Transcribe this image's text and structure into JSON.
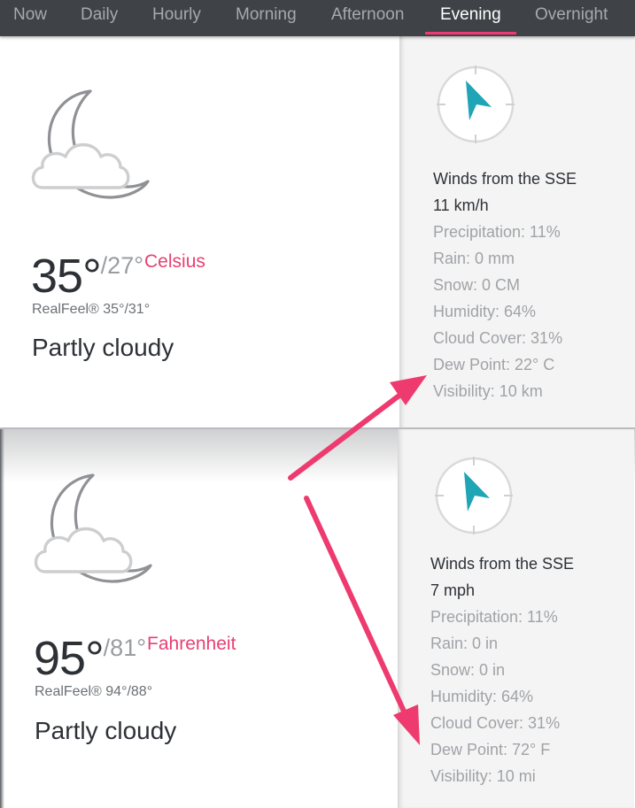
{
  "nav": {
    "tabs": [
      {
        "label": "Now",
        "active": false
      },
      {
        "label": "Daily",
        "active": false
      },
      {
        "label": "Hourly",
        "active": false
      },
      {
        "label": "Morning",
        "active": false
      },
      {
        "label": "Afternoon",
        "active": false
      },
      {
        "label": "Evening",
        "active": true
      },
      {
        "label": "Overnight",
        "active": false
      }
    ]
  },
  "colors": {
    "accent": "#f03a74",
    "compass_arrow": "#1fa5b5",
    "nav_bg": "#3f4347"
  },
  "celsius": {
    "icon": "partly-cloudy-night-icon",
    "temp_high": "35°",
    "temp_low": "/27°",
    "unit_label": "Celsius",
    "realfeel": "RealFeel® 35°/31°",
    "phrase": "Partly cloudy",
    "wind_direction": "Winds from the SSE",
    "wind_speed": "11 km/h",
    "precipitation": "Precipitation: 11%",
    "rain": "Rain: 0 mm",
    "snow": "Snow: 0 CM",
    "humidity": "Humidity: 64%",
    "cloud_cover": "Cloud Cover: 31%",
    "dew_point": "Dew Point: 22° C",
    "visibility": "Visibility: 10 km"
  },
  "fahrenheit": {
    "icon": "partly-cloudy-night-icon",
    "temp_high": "95°",
    "temp_low": "/81°",
    "unit_label": "Fahrenheit",
    "realfeel": "RealFeel® 94°/88°",
    "phrase": "Partly cloudy",
    "wind_direction": "Winds from the SSE",
    "wind_speed": "7 mph",
    "precipitation": "Precipitation: 11%",
    "rain": "Rain: 0 in",
    "snow": "Snow: 0 in",
    "humidity": "Humidity: 64%",
    "cloud_cover": "Cloud Cover: 31%",
    "dew_point": "Dew Point: 72° F",
    "visibility": "Visibility: 10 mi"
  }
}
